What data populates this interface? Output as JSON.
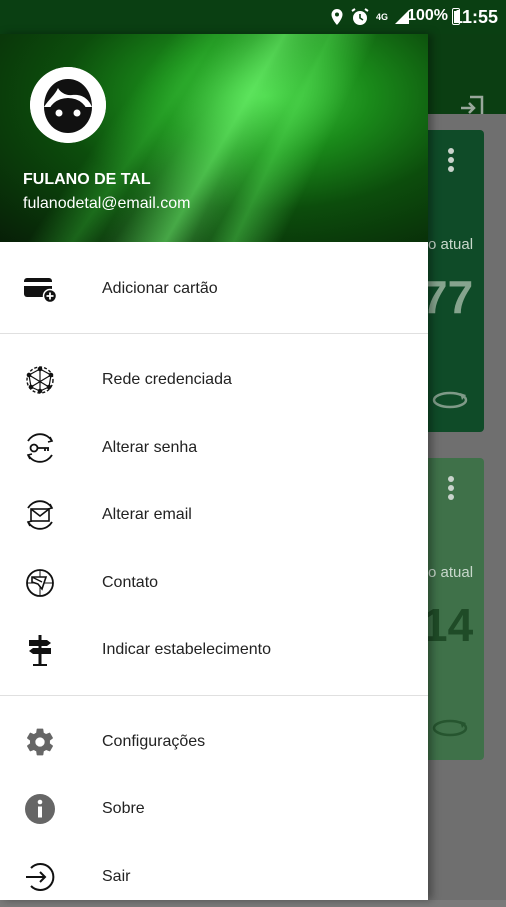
{
  "status_bar": {
    "network": "4G",
    "battery": "100%",
    "time": "11:55"
  },
  "background_cards": [
    {
      "label_partial": "o atual",
      "value_partial": "77"
    },
    {
      "label_partial": "o atual",
      "value_partial": "14"
    }
  ],
  "drawer": {
    "user": {
      "name": "FULANO DE TAL",
      "email": "fulanodetal@email.com"
    },
    "sections": [
      [
        {
          "label": "Adicionar cartão",
          "icon": "add-card-icon"
        }
      ],
      [
        {
          "label": "Rede credenciada",
          "icon": "network-icon"
        },
        {
          "label": "Alterar senha",
          "icon": "key-icon"
        },
        {
          "label": "Alterar email",
          "icon": "email-icon"
        },
        {
          "label": "Contato",
          "icon": "contact-icon"
        },
        {
          "label": "Indicar estabelecimento",
          "icon": "signpost-icon"
        }
      ],
      [
        {
          "label": "Configurações",
          "icon": "gear-icon"
        },
        {
          "label": "Sobre",
          "icon": "info-icon"
        },
        {
          "label": "Sair",
          "icon": "logout-icon"
        }
      ]
    ]
  },
  "colors": {
    "header_dark": "#0b3e12",
    "accent_green": "#2bb02b",
    "drawer_bg": "#ffffff",
    "icon_color": "#222222"
  }
}
